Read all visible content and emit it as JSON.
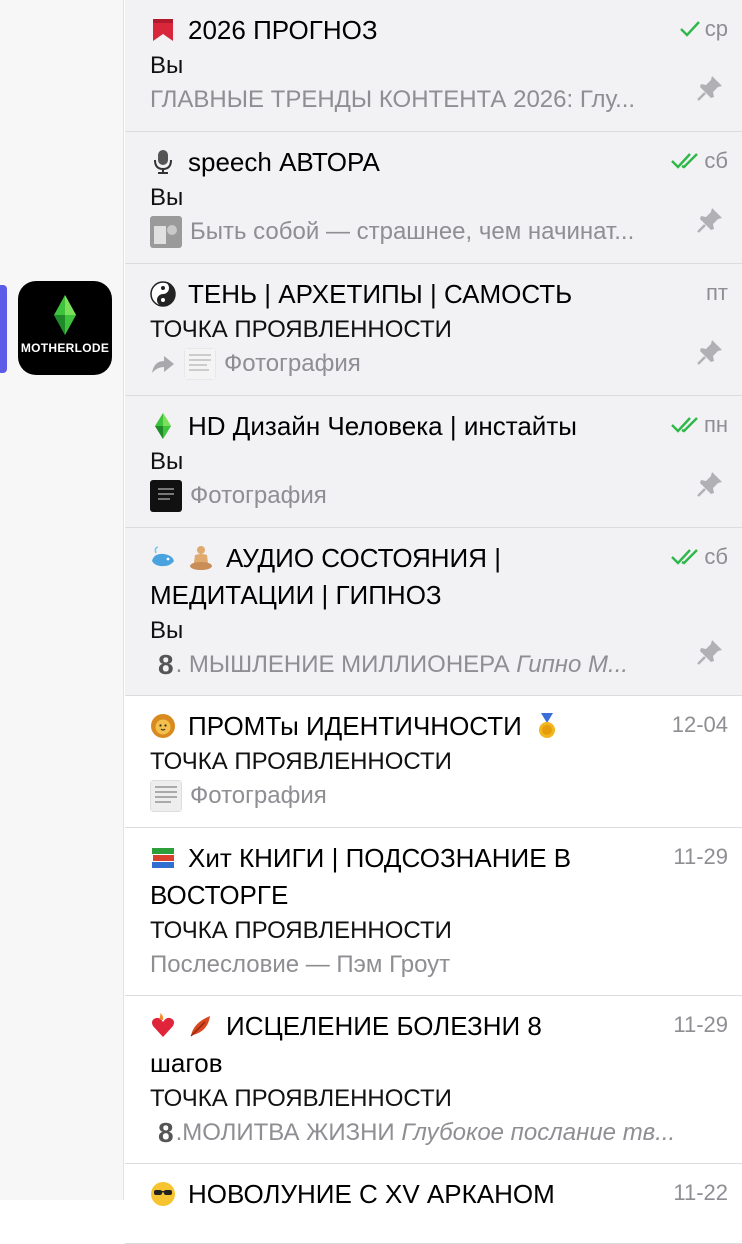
{
  "sidebar": {
    "folder_label": "MOTHERLODE"
  },
  "colors": {
    "check": "#2fb84a",
    "accent": "#5b5ce8",
    "muted": "#8e8e93"
  },
  "chats": [
    {
      "icon": "bookmark-icon",
      "title": "2026 ПРОГНОЗ",
      "sender": "Вы",
      "preview": "ГЛАВНЫЕ ТРЕНДЫ КОНТЕНТА 2026: Глу...",
      "time": "ср",
      "check": "single",
      "pinned": true
    },
    {
      "icon": "microphone-icon",
      "title": "speech АВТОРА",
      "sender": "Вы",
      "preview": "Быть собой — страшнее, чем начинат...",
      "time": "сб",
      "check": "double",
      "pinned": true
    },
    {
      "icon": "yin-yang-icon",
      "title": "ТЕНЬ | АРХЕТИПЫ | САМОСТЬ",
      "sender": "ТОЧКА ПРОЯВЛЕННОСТИ",
      "preview": "Фотография",
      "time": "пт",
      "pinned": true
    },
    {
      "icon": "green-gem-icon",
      "title": "HD Дизайн Человека | инстайты",
      "sender": "Вы",
      "preview": "Фотография",
      "time": "пн",
      "check": "double",
      "pinned": true
    },
    {
      "icon": "whale-meditation-icon",
      "title_line1": "АУДИО СОСТОЯНИЯ |",
      "title_line2": "МЕДИТАЦИИ | ГИПНОЗ",
      "sender": "Вы",
      "preview_num": "8",
      "preview": ". МЫШЛЕНИЕ МИЛЛИОНЕРА ",
      "preview_italic": "Гипно М...",
      "time": "сб",
      "check": "double",
      "pinned": true
    },
    {
      "icon": "lion-icon",
      "title": "ПРОМТы ИДЕНТИЧНОСТИ",
      "sender": "ТОЧКА ПРОЯВЛЕННОСТИ",
      "preview": "Фотография",
      "time": "12-04"
    },
    {
      "icon": "books-icon",
      "title_line1": "Хит КНИГИ | ПОДСОЗНАНИЕ В",
      "title_line2": "ВОСТОРГЕ",
      "sender": "ТОЧКА ПРОЯВЛЕННОСТИ",
      "preview": "Послесловие — Пэм Гроут",
      "time": "11-29"
    },
    {
      "icon": "heart-leaf-icon",
      "title_line1": "ИСЦЕЛЕНИЕ БОЛЕЗНИ 8",
      "title_line2": "шагов",
      "sender": "ТОЧКА ПРОЯВЛЕННОСТИ",
      "preview_num": "8",
      "preview": ".МОЛИТВА ЖИЗНИ ",
      "preview_italic": "Глубокое послание тв...",
      "time": "11-29"
    },
    {
      "icon": "cool-face-icon",
      "title": "НОВОЛУНИЕ С XV АРКАНОМ",
      "time": "11-22"
    }
  ]
}
